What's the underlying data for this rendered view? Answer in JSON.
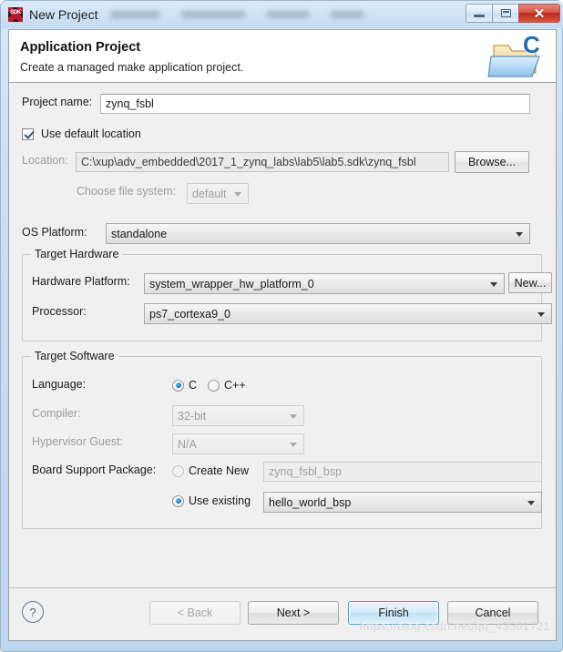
{
  "window": {
    "app_icon_label": "SDK",
    "title": "New Project",
    "controls": {
      "minimize": "minimize-button",
      "maximize": "maximize-button",
      "close": "✕"
    }
  },
  "header": {
    "title": "Application Project",
    "subtitle": "Create a managed make application project.",
    "icon": "c-folder-icon"
  },
  "form": {
    "project_name": {
      "label": "Project name:",
      "value": "zynq_fsbl",
      "placeholder": ""
    },
    "use_default_location": {
      "label": "Use default location",
      "checked": true
    },
    "location": {
      "label": "Location:",
      "value": "C:\\xup\\adv_embedded\\2017_1_zynq_labs\\lab5\\lab5.sdk\\zynq_fsbl",
      "browse_label": "Browse..."
    },
    "file_system": {
      "label": "Choose file system:",
      "value": "default"
    },
    "os_platform": {
      "label": "OS Platform:",
      "value": "standalone"
    }
  },
  "target_hardware": {
    "group_title": "Target Hardware",
    "hardware_platform": {
      "label": "Hardware Platform:",
      "value": "system_wrapper_hw_platform_0",
      "new_label": "New..."
    },
    "processor": {
      "label": "Processor:",
      "value": "ps7_cortexa9_0"
    }
  },
  "target_software": {
    "group_title": "Target Software",
    "language": {
      "label": "Language:",
      "options": [
        "C",
        "C++"
      ],
      "selected": "C"
    },
    "compiler": {
      "label": "Compiler:",
      "value": "32-bit",
      "enabled": false
    },
    "hypervisor_guest": {
      "label": "Hypervisor Guest:",
      "value": "N/A",
      "enabled": false
    },
    "board_support_package": {
      "label": "Board Support Package:",
      "create_new_label": "Create New",
      "create_new_value": "zynq_fsbl_bsp",
      "use_existing_label": "Use existing",
      "use_existing_value": "hello_world_bsp",
      "selected": "Use existing"
    }
  },
  "footer": {
    "help": "?",
    "back": "< Back",
    "next": "Next >",
    "finish": "Finish",
    "cancel": "Cancel"
  },
  "watermark": "https://blog.csdn.net/qq_43501721"
}
